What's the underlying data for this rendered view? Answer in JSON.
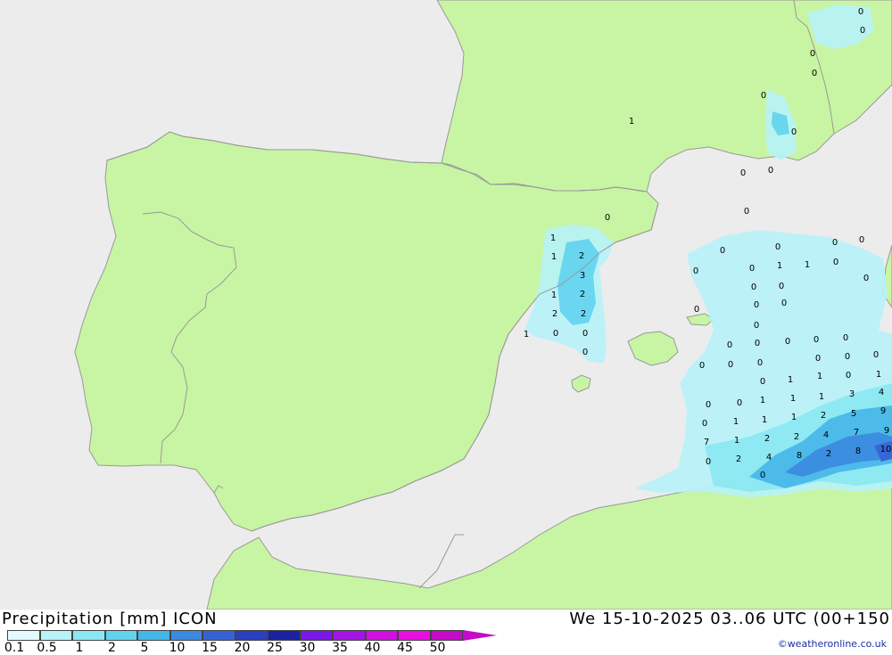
{
  "title": "Precipitation [mm]  ICON",
  "datetime": "We 15-10-2025 03..06 UTC (00+150",
  "credit": "©weatheronline.co.uk",
  "colors": {
    "sea": "#ececec",
    "land": "#c8f5a3",
    "border": "#999999"
  },
  "legend": {
    "labels": [
      "0.1",
      "0.5",
      "1",
      "2",
      "5",
      "10",
      "15",
      "20",
      "25",
      "30",
      "35",
      "40",
      "45",
      "50"
    ],
    "colors": [
      "#e3fbff",
      "#b7f3f8",
      "#8ae8f2",
      "#61d3ee",
      "#45b6e8",
      "#3b8ae0",
      "#3563d6",
      "#2b3fc1",
      "#1a22a3",
      "#7a18e8",
      "#a414e4",
      "#d10fe0",
      "#e80ee0",
      "#c50ac8"
    ]
  },
  "values": [
    "0",
    "0",
    "0",
    "0",
    "0",
    "1",
    "0",
    "0",
    "0",
    "0",
    "1",
    "2",
    "1",
    "3",
    "1",
    "2",
    "2",
    "2",
    "1",
    "0",
    "0",
    "0",
    "0",
    "0",
    "0",
    "0",
    "0",
    "1",
    "1",
    "0",
    "0",
    "0",
    "0",
    "0",
    "0",
    "0",
    "0",
    "0",
    "0",
    "0",
    "0",
    "0",
    "0",
    "0",
    "0",
    "0",
    "0",
    "0",
    "0",
    "0",
    "1",
    "0",
    "1",
    "0",
    "1",
    "1",
    "1",
    "1",
    "3",
    "4",
    "1",
    "1",
    "1",
    "2",
    "5",
    "9",
    "7",
    "1",
    "2",
    "2",
    "4",
    "7",
    "9",
    "10",
    "0",
    "2",
    "4",
    "8",
    "2",
    "8",
    "0",
    "0",
    "0",
    "0"
  ]
}
